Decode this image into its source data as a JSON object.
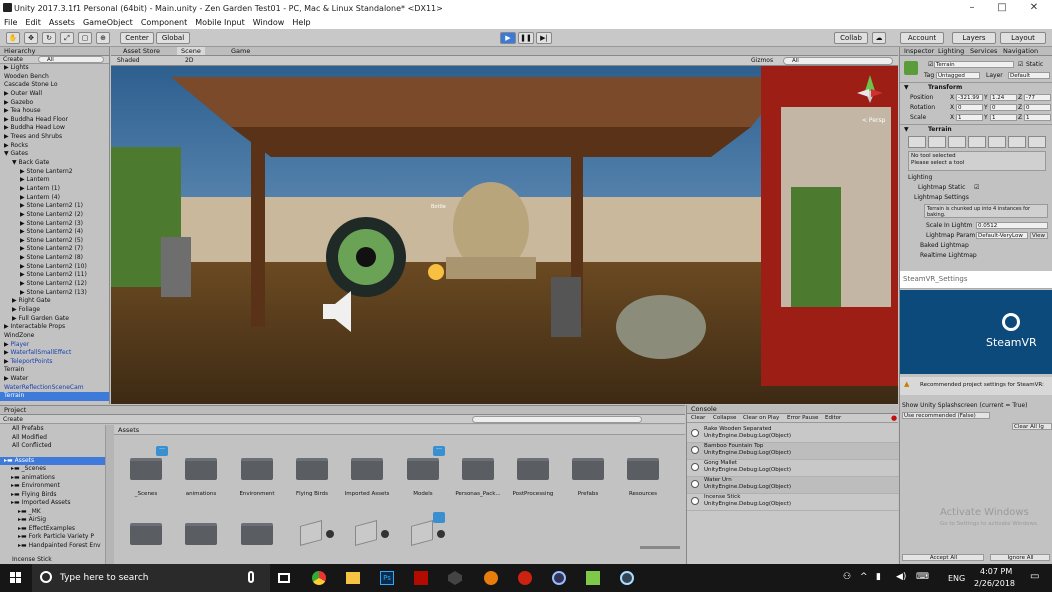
{
  "window": {
    "title": "Unity 2017.3.1f1 Personal (64bit) - Main.unity - Zen Garden Test01 - PC, Mac & Linux Standalone* <DX11>"
  },
  "menu": [
    "File",
    "Edit",
    "Assets",
    "GameObject",
    "Component",
    "Mobile Input",
    "Window",
    "Help"
  ],
  "toolbar": {
    "center": "Center",
    "global": "Global",
    "collab": "Collab",
    "account": "Account",
    "layers": "Layers",
    "layout": "Layout"
  },
  "hierarchy": {
    "tab": "Hierarchy",
    "create": "Create",
    "search": "All",
    "items": [
      "Lights",
      "Wooden Bench",
      "Cascade Stone Lo",
      "Outer Wall",
      "Gazebo",
      "Tea house",
      "Buddha Head Floor",
      "Buddha Head Low",
      "Trees and Shrubs",
      "Rocks",
      "Gates",
      "Back Gate",
      "Stone Lantern2",
      "Lantern",
      "Lantern (1)",
      "Lantern (4)",
      "Stone Lantern2 (1)",
      "Stone Lantern2 (2)",
      "Stone Lantern2 (3)",
      "Stone Lantern2 (4)",
      "Stone Lantern2 (5)",
      "Stone Lantern2 (7)",
      "Stone Lantern2 (8)",
      "Stone Lantern2 (10)",
      "Stone Lantern2 (11)",
      "Stone Lantern2 (12)",
      "Stone Lantern2 (13)",
      "Right Gate",
      "Foliage",
      "Full Garden Gate",
      "Interactable Props",
      "WindZone",
      "Player",
      "WaterfallSmallEffect",
      "TeleportPoints",
      "Terrain",
      "Water",
      "WaterReflectionSceneCam",
      "Terrain"
    ]
  },
  "scene": {
    "tabs": [
      "Asset Store",
      "Scene",
      "Game"
    ],
    "shading": "Shaded",
    "mode": "2D",
    "gizmos": "Gizmos",
    "search": "All",
    "persp": "< Persp",
    "label": "Bottle"
  },
  "inspector": {
    "tabs": [
      "Inspector",
      "Lighting",
      "Services",
      "Navigation"
    ],
    "object_name": "Terrain",
    "static": "Static",
    "tag_label": "Tag",
    "tag": "Untagged",
    "layer_label": "Layer",
    "layer": "Default",
    "transform": "Transform",
    "position": "Position",
    "rotation": "Rotation",
    "scale": "Scale",
    "pos": [
      "-321.99",
      "1.24",
      "-77"
    ],
    "rot": [
      "0",
      "0",
      "0"
    ],
    "scl": [
      "1",
      "1",
      "1"
    ],
    "terrain": "Terrain",
    "no_tool": "No tool selected",
    "select_tool": "Please select a tool",
    "lighting": "Lighting",
    "lightmap_static": "Lightmap Static",
    "lightmap_settings": "Lightmap Settings",
    "info": "Terrain is chunked up into 4 instances for baking.",
    "scale_lightmap": "Scale In Lightm",
    "scale_val": "0.0512",
    "param": "Lightmap Param",
    "param_val": "Default-VeryLow",
    "view": "View",
    "baked": "Baked Lightmap",
    "realtime": "Realtime Lightmap",
    "steam_title": "SteamVR_Settings",
    "steam_logo": "SteamVR",
    "recommended": "Recommended project settings for SteamVR:",
    "splash": "Show Unity Splashscreen (current = True)",
    "use_rec": "Use recommended (False)",
    "clear_all": "Clear All Ig",
    "accept_all": "Accept All",
    "ignore_all": "Ignore All",
    "watermark1": "Activate Windows",
    "watermark2": "Go to Settings to activate Windows."
  },
  "project": {
    "tab": "Project",
    "create": "Create",
    "favorites": [
      "All Prefabs",
      "All Modified",
      "All Conflicted"
    ],
    "tree": [
      "Assets",
      "_Scenes",
      "animations",
      "Environment",
      "Flying Birds",
      "Imported Assets",
      "_MK",
      "AirSig",
      "EffectExamples",
      "Fork Particle Variety P",
      "Handpainted Forest Env"
    ],
    "breadcrumb": "Assets",
    "folders": [
      "_Scenes",
      "animations",
      "Environment",
      "Flying Birds",
      "Imported Assets",
      "Models",
      "Personas_Pack...",
      "PostProcessing",
      "Prefabs",
      "Resources"
    ],
    "status": "Incense Stick"
  },
  "console": {
    "tab": "Console",
    "buttons": [
      "Clear",
      "Collapse",
      "Clear on Play",
      "Error Pause",
      "Editor"
    ],
    "entries": [
      {
        "t": "Rake Wooden Separated",
        "s": "UnityEngine.Debug:Log(Object)"
      },
      {
        "t": "Bamboo Fountain Top",
        "s": "UnityEngine.Debug:Log(Object)"
      },
      {
        "t": "Gong Mallet",
        "s": "UnityEngine.Debug:Log(Object)"
      },
      {
        "t": "Water Urn",
        "s": "UnityEngine.Debug:Log(Object)"
      },
      {
        "t": "Incense Stick",
        "s": "UnityEngine.Debug:Log(Object)"
      }
    ]
  },
  "taskbar": {
    "search": "Type here to search",
    "lang": "ENG",
    "time": "4:07 PM",
    "date": "2/26/2018"
  }
}
